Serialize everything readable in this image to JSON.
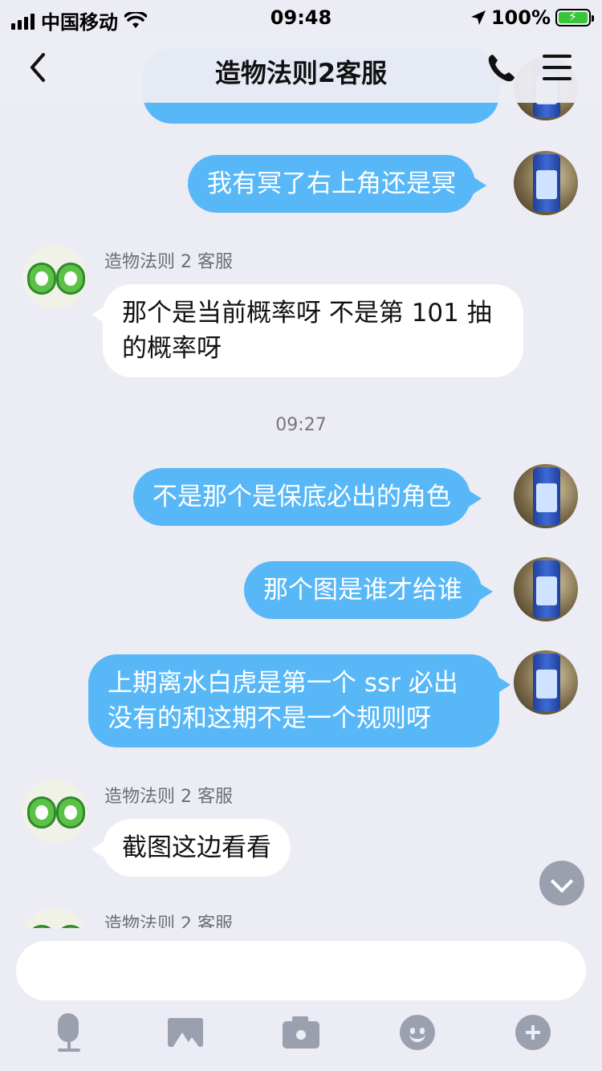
{
  "status_bar": {
    "carrier": "中国移动",
    "time": "09:48",
    "battery": "100%",
    "icons": [
      "signal-icon",
      "wifi-icon",
      "location-icon",
      "battery-charging-icon"
    ]
  },
  "nav": {
    "title": "造物法则2客服",
    "icons": [
      "back-icon",
      "phone-icon",
      "menu-icon"
    ]
  },
  "messages": [
    {
      "type": "out",
      "text": ""
    },
    {
      "type": "out",
      "text": "我有冥了右上角还是冥"
    },
    {
      "type": "in",
      "sender": "造物法则 2 客服",
      "text": "那个是当前概率呀 不是第 101 抽的概率呀"
    },
    {
      "type": "time",
      "text": "09:27"
    },
    {
      "type": "out",
      "text": "不是那个是保底必出的角色"
    },
    {
      "type": "out",
      "text": "那个图是谁才给谁"
    },
    {
      "type": "out",
      "text": "上期离水白虎是第一个 ssr 必出没有的和这期不是一个规则呀"
    },
    {
      "type": "in",
      "sender": "造物法则 2 客服",
      "text": "截图这边看看"
    },
    {
      "type": "in",
      "sender": "造物法则 2 客服",
      "text": ""
    }
  ],
  "input": {
    "value": "",
    "placeholder": ""
  },
  "toolbar": [
    "microphone-icon",
    "image-icon",
    "camera-icon",
    "emoji-icon",
    "plus-icon"
  ],
  "colors": {
    "outgoing_bubble": "#58b8f7",
    "incoming_bubble": "#ffffff",
    "background": "#ececf4",
    "icon_gray": "#9aa0ae"
  }
}
